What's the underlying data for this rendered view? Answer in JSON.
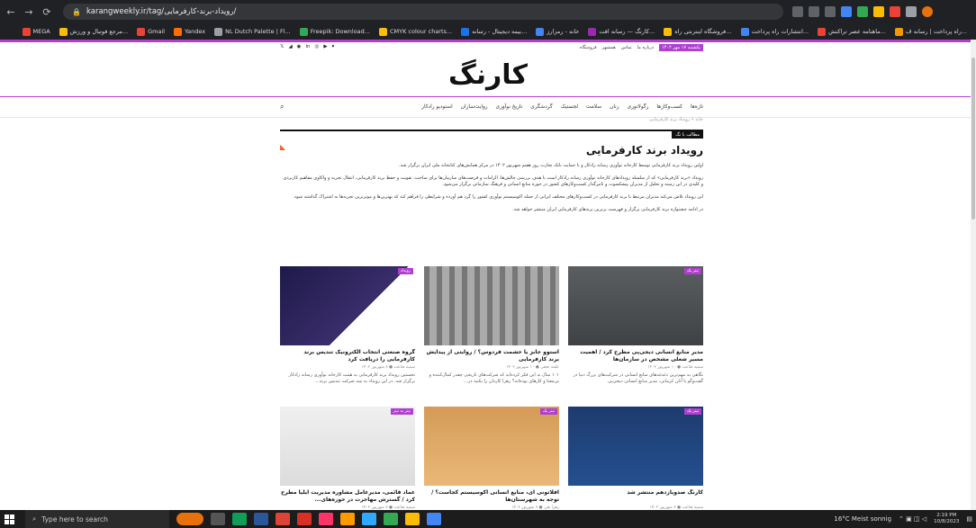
{
  "browser": {
    "url": "karangweekly.ir/tag/رویداد-برند-کارفرمایی/",
    "bookmarks": [
      "راه پرداخت | رسانه ف...",
      "ماهنامه عصر تراکنش...",
      "انتشارات راه پرداخت...",
      "فروشگاه اینترنتی راه...",
      "کارنگ — رسانه اقت...",
      "خانه - رمزارز",
      "بیمه دیجیتال - رسانه...",
      "CMYK colour charts...",
      "Freepik: Download...",
      "NL Dutch Palette | Fl...",
      "Yandex",
      "Gmail",
      "مرجع فوتبال و ورزش...",
      "MEGA"
    ]
  },
  "site": {
    "social": [
      "𝕏",
      "◢",
      "◉",
      "in",
      "◎",
      "▶",
      "▾"
    ],
    "toplinks": [
      "درباره ما",
      "تماس",
      "همشهر",
      "فروشگاه"
    ],
    "date": "یکشنبه ۱۷ مهر ۱۴۰۲",
    "logo": "کارنگ",
    "nav": [
      "تازه‌ها",
      "کسب‌وکارها",
      "رگولاتوری",
      "زنان",
      "سلامت",
      "لجستیک",
      "گردشگری",
      "تاریخ نوآوری",
      "روایت‌سازان",
      "استودیو رادکار"
    ],
    "breadcrumb": "خانه » رویداد برند کارفرمایی",
    "tag_label": "مطالب با تگ",
    "page_title": "رویداد برند کارفرمایی",
    "paragraphs": [
      "اولین رویداد برند کارفرمایی توسط کارخانه نوآوری رسانه رادکار و با حمایت بانک تجارت روز هفتم شهریور ۱۴۰۲ در مرکز همایش‌های کتابخانه ملی ایران برگزار شد.",
      "رویداد «برند کارفرمایی» که از سلسله رویدادهای کارخانه نوآوری رسانه رادکار است با هدف بررسی چالش‌ها، الزامات و فرصت‌های سازمان‌ها برای ساخت، تقویت و حفظ برند کارفرمایی، انتقال تجربه و واکاوی مفاهیم کاربردی و کلیدی در این زمینه و تحلیل از مدیران پیشکسوت و تاثیرگذار کسب‌وکارهای کشور در حوزه منابع انسانی و فرهنگ سازمانی برگزار می‌شود.",
      "این رویداد تلاش می‌کند مدیران مرتبط با برند کارفرمایی در کسب‌وکارهای مختلف ایرانی از جمله اکوسیستم نوآوری کشور را گرد هم آورده و شرایطی را فراهم کند که بهترین‌ها و موثرترین تجربه‌ها به اشتراک گذاشته شود.",
      "در ادامه جشنواره برند کارفرمایی برگزار و فهرست برترین برندهای کارفرمایی ایران منتشر خواهد شد."
    ]
  },
  "cards": [
    {
      "badge": "تیتر یک",
      "title": "مدیر منابع انسانی دیجی‌پی مطرح کرد / اهمیت مسیر شغلی مشخص در سازمان‌ها",
      "meta": "سمیه قناعت ● ۱۰ شهریور ۱۴۰۲",
      "excerpt": "نگاهی به مهم‌ترین دغدغه‌های منابع انسانی در شرکت‌های بزرگ دنیا در گفت‌وگو با آنان کرمانی، مدیر منابع انسانی دیجی‌پی"
    },
    {
      "badge": "",
      "title": "استوو جابز یا حشمت فردوس؟ / روایتی از پیدایش برند کارفرمایی",
      "meta": "علمه نجفی ● ۱۰ شهریور ۱۴۰۲",
      "excerpt": "۱۰۱ سال به این فکر کرده‌اید که شرکت‌های تاریخی چقدر کمال‌کننده و بی‌معنا و کارهای بوده‌اند؟ زهرا کاردان را بکنید در..."
    },
    {
      "badge": "رویداد",
      "title": "گروه صنعتی انتخاب الکترونیک تندیس برند کارفرمایی را دریافت کرد",
      "meta": "سمیه قناعت ● ۸ شهریور ۱۴۰۲",
      "excerpt": "نخستین رویداد برند کارفرمایی به همت کارخانه نوآوری رسانه رادکار برگزار شد. در این رویداد به سه شرکت تندیس برند..."
    },
    {
      "badge": "تیتر یک",
      "title": "کارنگ صدویازدهم منتشر شد",
      "meta": "سمیه قناعت ● ۷ شهریور ۱۴۰۲",
      "excerpt": "هفته‌نامه اقتصاد نوآوری ایران این هفته به صدویازدهمین شماره خود رسید. در این شماره به آنچه در رویداد برند..."
    },
    {
      "badge": "تیتر یک",
      "title": "افلاتونی آی، منابع انسانی اکوسیستم کجاست؟ / توجه به شهرستان‌ها",
      "meta": "زهرا تقی ● ۷ شهریور ۱۴۰۲",
      "excerpt": "برای عبور از بحران دو سه سال آینده، کاری که از دست ما برمی‌آید، توجه به شهرستان‌هاست."
    },
    {
      "badge": "تیتر به تیتر",
      "title": "عماد قائمی، مدیرعامل مشاوره مدیریت ایلیا مطرح کرد / گسترش مهاجرت در حوزه‌های...",
      "meta": "سمیه قناعت ● ۷ شهریور ۱۴۰۲",
      "excerpt": "نگاهی به عوامل چالش کمبود منابع انسانی در گفت‌وگو با عماد قائمی، مدیرعامل شرکت مشاوره مدیریت ایلیا"
    }
  ],
  "taskbar": {
    "search": "Type here to search",
    "weather": "16°C  Meist sonnig",
    "time": "2:19 PM",
    "date": "10/8/2023"
  }
}
